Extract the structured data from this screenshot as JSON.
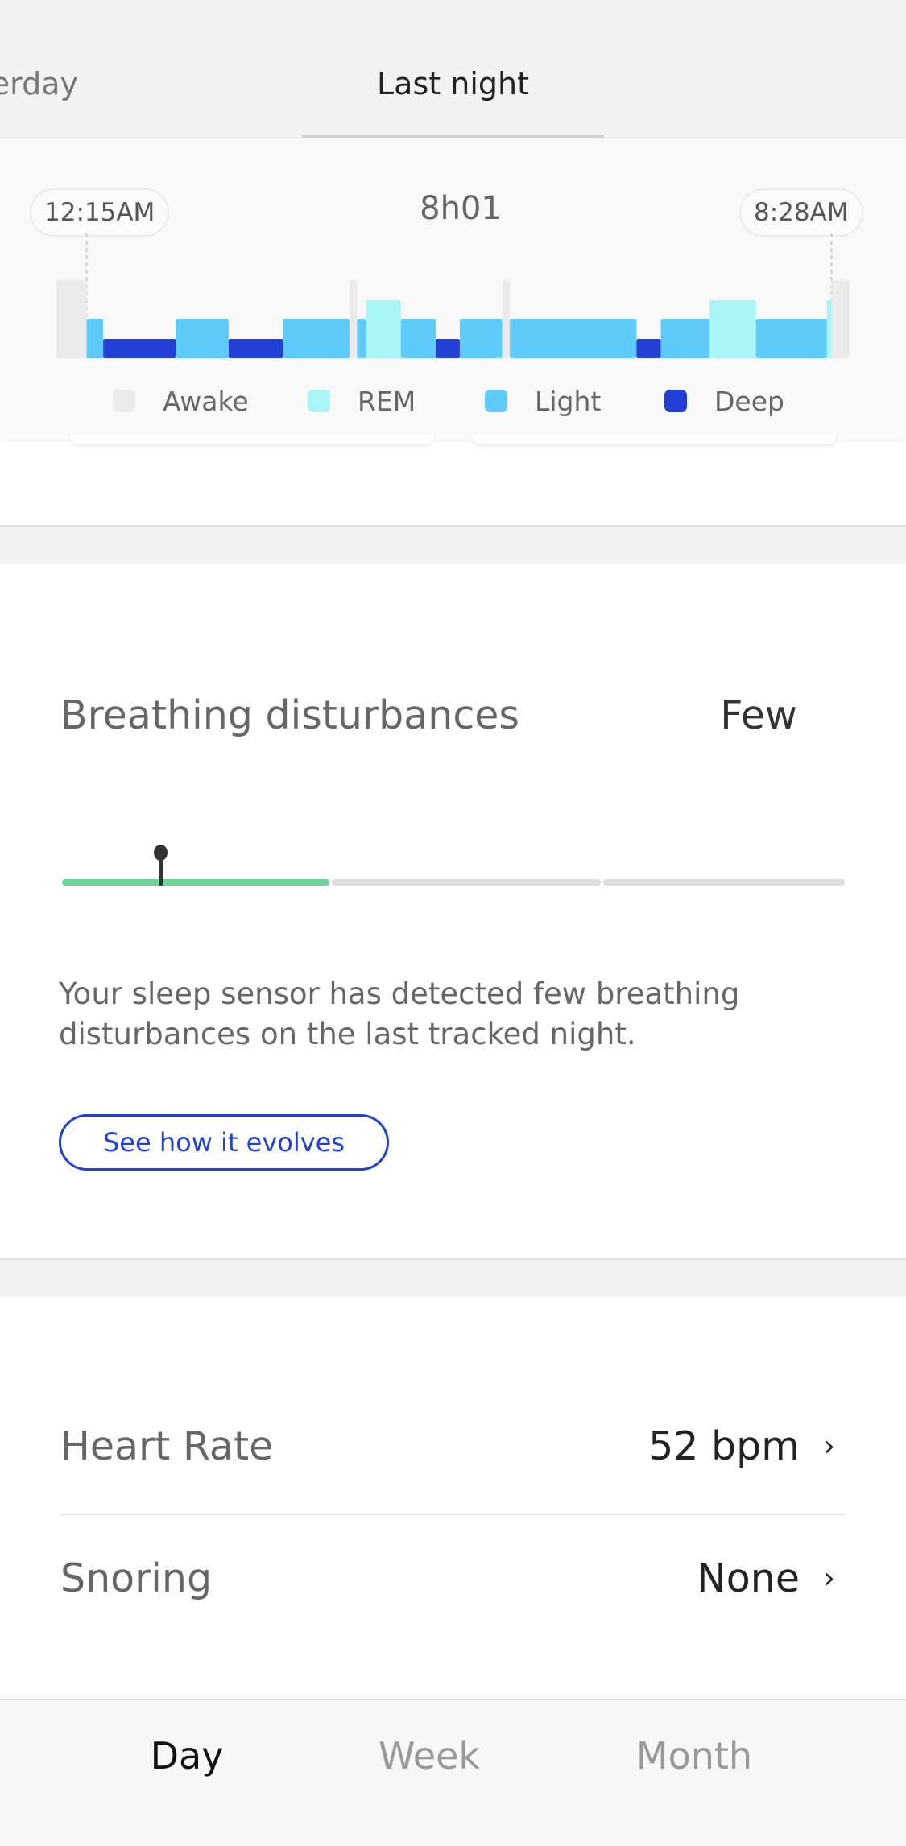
{
  "top_tabs": [
    {
      "label": "erday",
      "active": false
    },
    {
      "label": "Last night",
      "active": true
    }
  ],
  "chart_data": {
    "type": "bar",
    "subtype": "sleep-hypnogram",
    "start_label": "12:15AM",
    "end_label": "8:28AM",
    "duration": "8h01",
    "legend": [
      {
        "name": "Awake",
        "color": "#ebebeb"
      },
      {
        "name": "REM",
        "color": "#a8f5f5"
      },
      {
        "name": "Light",
        "color": "#5ecbfa"
      },
      {
        "name": "Deep",
        "color": "#2240d6"
      }
    ],
    "segments": [
      {
        "stage": "Awake",
        "start": "23:55",
        "end": "00:15"
      },
      {
        "stage": "Light",
        "start": "00:15",
        "end": "00:26"
      },
      {
        "stage": "Deep",
        "start": "00:26",
        "end": "01:14"
      },
      {
        "stage": "Light",
        "start": "01:14",
        "end": "01:49"
      },
      {
        "stage": "Deep",
        "start": "01:49",
        "end": "02:25"
      },
      {
        "stage": "Light",
        "start": "02:25",
        "end": "03:09"
      },
      {
        "stage": "Awake",
        "start": "03:09",
        "end": "03:14"
      },
      {
        "stage": "Light",
        "start": "03:14",
        "end": "03:20"
      },
      {
        "stage": "REM",
        "start": "03:20",
        "end": "03:43"
      },
      {
        "stage": "Light",
        "start": "03:43",
        "end": "04:06"
      },
      {
        "stage": "Deep",
        "start": "04:06",
        "end": "04:22"
      },
      {
        "stage": "Light",
        "start": "04:22",
        "end": "04:50"
      },
      {
        "stage": "Awake",
        "start": "04:50",
        "end": "04:55"
      },
      {
        "stage": "Light",
        "start": "04:55",
        "end": "06:19"
      },
      {
        "stage": "Deep",
        "start": "06:19",
        "end": "06:35"
      },
      {
        "stage": "Light",
        "start": "06:35",
        "end": "07:07"
      },
      {
        "stage": "REM",
        "start": "07:07",
        "end": "07:38"
      },
      {
        "stage": "Light",
        "start": "07:38",
        "end": "08:25"
      },
      {
        "stage": "REM",
        "start": "08:25",
        "end": "08:28"
      },
      {
        "stage": "Awake",
        "start": "08:28",
        "end": "08:40"
      }
    ]
  },
  "breathing": {
    "title": "Breathing disturbances",
    "value": "Few",
    "level_fraction": 0.125,
    "scale_colors": {
      "active": "#6fd49c",
      "inactive": "#dcdcdc"
    },
    "description": "Your sleep sensor has detected few breathing disturbances on the last tracked night.",
    "button": "See how it evolves"
  },
  "metrics": [
    {
      "label": "Heart Rate",
      "value": "52 bpm"
    },
    {
      "label": "Snoring",
      "value": "None"
    }
  ],
  "bottom_tabs": [
    {
      "label": "Day",
      "active": true
    },
    {
      "label": "Week",
      "active": false
    },
    {
      "label": "Month",
      "active": false
    }
  ],
  "accent": "#2240d6"
}
